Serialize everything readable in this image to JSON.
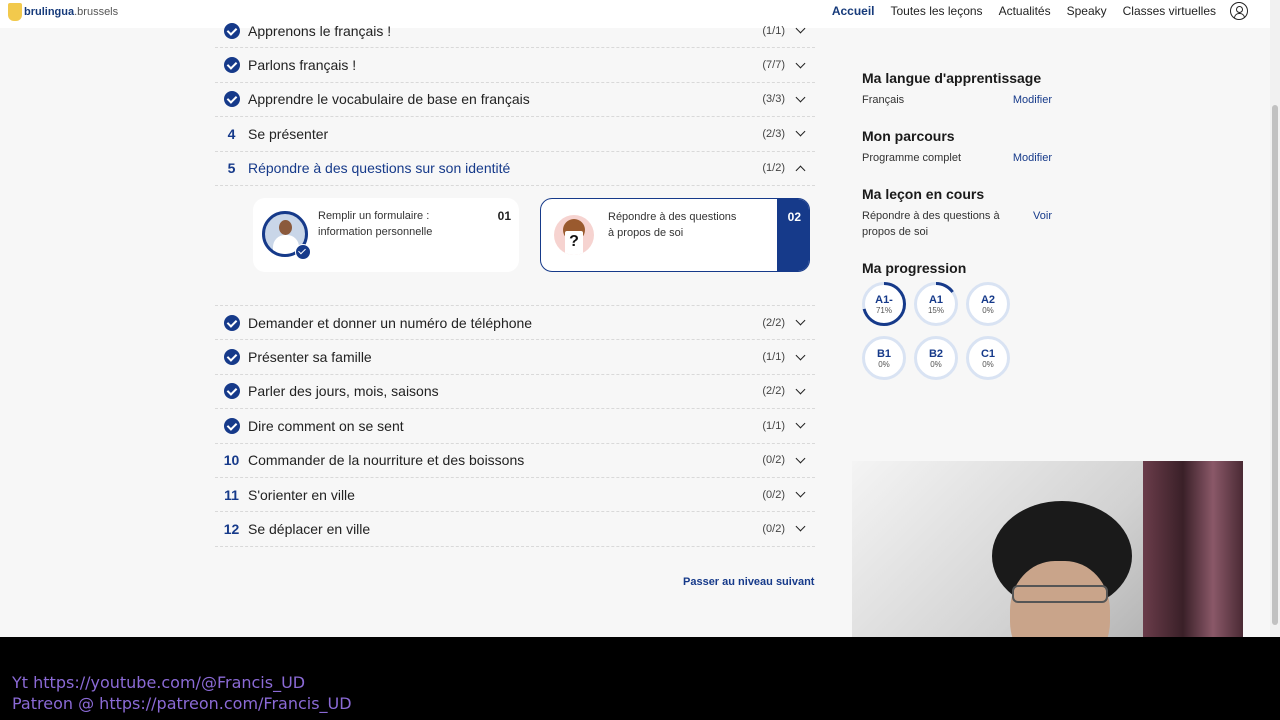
{
  "brand": {
    "name": "brulingua",
    "domain": ".brussels"
  },
  "nav": {
    "items": [
      "Accueil",
      "Toutes les leçons",
      "Actualités",
      "Speaky",
      "Classes virtuelles"
    ],
    "active": "Accueil"
  },
  "lessons_top": [
    {
      "marker": "check",
      "title": "Apprenons le français !",
      "count": "(1/1)"
    },
    {
      "marker": "check",
      "title": "Parlons français !",
      "count": "(7/7)"
    },
    {
      "marker": "check",
      "title": "Apprendre le vocabulaire de base en français",
      "count": "(3/3)"
    },
    {
      "marker": "4",
      "title": "Se présenter",
      "count": "(2/3)"
    },
    {
      "marker": "5",
      "title": "Répondre à des questions sur son identité",
      "count": "(1/2)"
    }
  ],
  "sublessons": [
    {
      "num": "01",
      "text": "Remplir un formulaire : information personnelle"
    },
    {
      "num": "02",
      "text": "Répondre à des questions à propos de soi"
    }
  ],
  "lessons_bottom": [
    {
      "marker": "check",
      "title": "Demander et donner un numéro de téléphone",
      "count": "(2/2)"
    },
    {
      "marker": "check",
      "title": "Présenter sa famille",
      "count": "(1/1)"
    },
    {
      "marker": "check",
      "title": "Parler des jours, mois, saisons",
      "count": "(2/2)"
    },
    {
      "marker": "check",
      "title": "Dire comment on se sent",
      "count": "(1/1)"
    },
    {
      "marker": "10",
      "title": "Commander de la nourriture et des boissons",
      "count": "(0/2)"
    },
    {
      "marker": "11",
      "title": "S'orienter en ville",
      "count": "(0/2)"
    },
    {
      "marker": "12",
      "title": "Se déplacer en ville",
      "count": "(0/2)"
    }
  ],
  "next_level_link": "Passer au niveau suivant",
  "panel": {
    "language": {
      "title": "Ma langue d'apprentissage",
      "value": "Français",
      "action": "Modifier"
    },
    "path": {
      "title": "Mon parcours",
      "value": "Programme complet",
      "action": "Modifier"
    },
    "current": {
      "title": "Ma leçon en cours",
      "value": "Répondre à des questions à propos de soi",
      "action": "Voir"
    },
    "progress": {
      "title": "Ma progression",
      "levels": [
        {
          "name": "A1-",
          "pct": "71%",
          "value": 71
        },
        {
          "name": "A1",
          "pct": "15%",
          "value": 15
        },
        {
          "name": "A2",
          "pct": "0%",
          "value": 0
        },
        {
          "name": "B1",
          "pct": "0%",
          "value": 0
        },
        {
          "name": "B2",
          "pct": "0%",
          "value": 0
        },
        {
          "name": "C1",
          "pct": "0%",
          "value": 0
        }
      ]
    }
  },
  "banner": {
    "line1": "Yt https://youtube.com/@Francis_UD",
    "line2": "Patreon @ https://patreon.com/Francis_UD"
  },
  "colors": {
    "accent": "#163a8a",
    "banner_text": "#8b6ad6"
  }
}
